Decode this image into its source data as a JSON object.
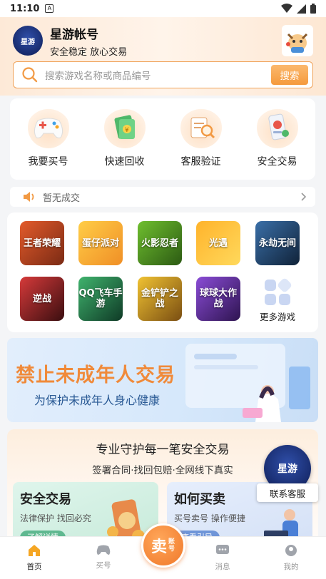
{
  "status_bar": {
    "time": "11:10",
    "notif_icon": "A"
  },
  "header": {
    "app_title": "星游帐号",
    "app_subtitle": "安全稳定 放心交易",
    "logo_text": "星游"
  },
  "search": {
    "placeholder": "搜索游戏名称或商品编号",
    "button_label": "搜索"
  },
  "features": [
    {
      "label": "我要买号",
      "icon": "gamepad-icon"
    },
    {
      "label": "快速回收",
      "icon": "cash-icon"
    },
    {
      "label": "客服验证",
      "icon": "verify-icon"
    },
    {
      "label": "安全交易",
      "icon": "phone-shield-icon"
    }
  ],
  "notice": {
    "text": "暂无成交"
  },
  "games": [
    {
      "label": "王者荣耀",
      "colors": [
        "#e35b2b",
        "#7a2a14"
      ]
    },
    {
      "label": "蛋仔派对",
      "colors": [
        "#ffcd47",
        "#f08f26"
      ]
    },
    {
      "label": "火影忍者",
      "colors": [
        "#6fbf2f",
        "#2c5a13"
      ]
    },
    {
      "label": "光遇",
      "colors": [
        "#ffb32b",
        "#ffd95c"
      ]
    },
    {
      "label": "永劫无间",
      "colors": [
        "#3a6fa8",
        "#102238"
      ]
    },
    {
      "label": "逆战",
      "colors": [
        "#d63a3a",
        "#3a0e10"
      ]
    },
    {
      "label": "QQ飞车手游",
      "colors": [
        "#3fb36d",
        "#0f3a26"
      ]
    },
    {
      "label": "金铲铲之战",
      "colors": [
        "#f0c232",
        "#7a4e12"
      ]
    },
    {
      "label": "球球大作战",
      "colors": [
        "#8a4cd6",
        "#2e1450"
      ]
    }
  ],
  "more_games": {
    "label": "更多游戏"
  },
  "banner": {
    "title": "禁止未成年人交易",
    "subtitle": "为保护未成年人身心健康"
  },
  "trust": {
    "title": "专业守护每一笔安全交易",
    "subtitle": "签署合同·找回包赔·全网线下真实",
    "cards": [
      {
        "title": "安全交易",
        "subtitle": "法律保护 找回必究",
        "link": "了解详情"
      },
      {
        "title": "如何买卖",
        "subtitle": "买号卖号 操作便捷",
        "link": "查看引导"
      }
    ]
  },
  "support": {
    "logo_text": "星游",
    "label": "联系客服"
  },
  "tabbar": {
    "home": "首页",
    "buy": "买号",
    "sell_main": "卖",
    "sell_small": "账号",
    "messages": "消息",
    "mine": "我的"
  },
  "colors": {
    "accent": "#f59a3d",
    "search_border": "#f0a35a",
    "banner_title": "#f08a3a"
  }
}
